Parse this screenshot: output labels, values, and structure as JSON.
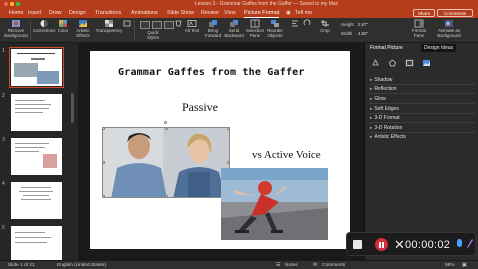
{
  "window": {
    "title": "Lesson 3 - Grammar Gaffes from the Gaffer — Saved to my Mac"
  },
  "tabs": [
    {
      "label": "Home"
    },
    {
      "label": "Insert"
    },
    {
      "label": "Draw"
    },
    {
      "label": "Design"
    },
    {
      "label": "Transitions"
    },
    {
      "label": "Animations"
    },
    {
      "label": "Slide Show"
    },
    {
      "label": "Review"
    },
    {
      "label": "View"
    },
    {
      "label": "Picture Format"
    },
    {
      "label": "Tell me"
    }
  ],
  "actions": {
    "share": "Share",
    "comments": "Comments"
  },
  "toolbar": {
    "remove_background": "Remove Background",
    "corrections": "Corrections",
    "color": "Color",
    "artistic_effects": "Artistic Effects",
    "transparency": "Transparency",
    "quick_styles": "Quick Styles",
    "alt_text": "Alt Text",
    "bring_forward": "Bring Forward",
    "send_backward": "Send Backward",
    "selection_pane": "Selection Pane",
    "reorder_objects": "Reorder Objects",
    "crop": "Crop",
    "height_label": "Height",
    "height_value": "2.67\"",
    "width_label": "Width",
    "width_value": "4.82\"",
    "format_pane": "Format Pane",
    "animate_as_background": "Animate as Background"
  },
  "thumbnails": [
    {
      "number": "1",
      "selected": true
    },
    {
      "number": "2",
      "selected": false
    },
    {
      "number": "3",
      "selected": false
    },
    {
      "number": "4",
      "selected": false
    },
    {
      "number": "5",
      "selected": false
    }
  ],
  "slide": {
    "title": "Grammar Gaffes from the Gaffer",
    "passive": "Passive",
    "vs_active": "vs Active Voice"
  },
  "format_panel": {
    "tab_format": "Format Picture",
    "tab_design": "Design Ideas",
    "sections": [
      "Shadow",
      "Reflection",
      "Glow",
      "Soft Edges",
      "3-D Format",
      "3-D Rotation",
      "Artistic Effects"
    ]
  },
  "status": {
    "slide_of": "Slide 1 of 21",
    "language": "English (United States)",
    "notes": "Notes",
    "comments": "Comments",
    "zoom": "98%"
  },
  "recording": {
    "time": "00:00:02"
  },
  "colors": {
    "ribbon": "#b53d1c",
    "record_red": "#d62c3b",
    "accent": "#d04a2a"
  }
}
